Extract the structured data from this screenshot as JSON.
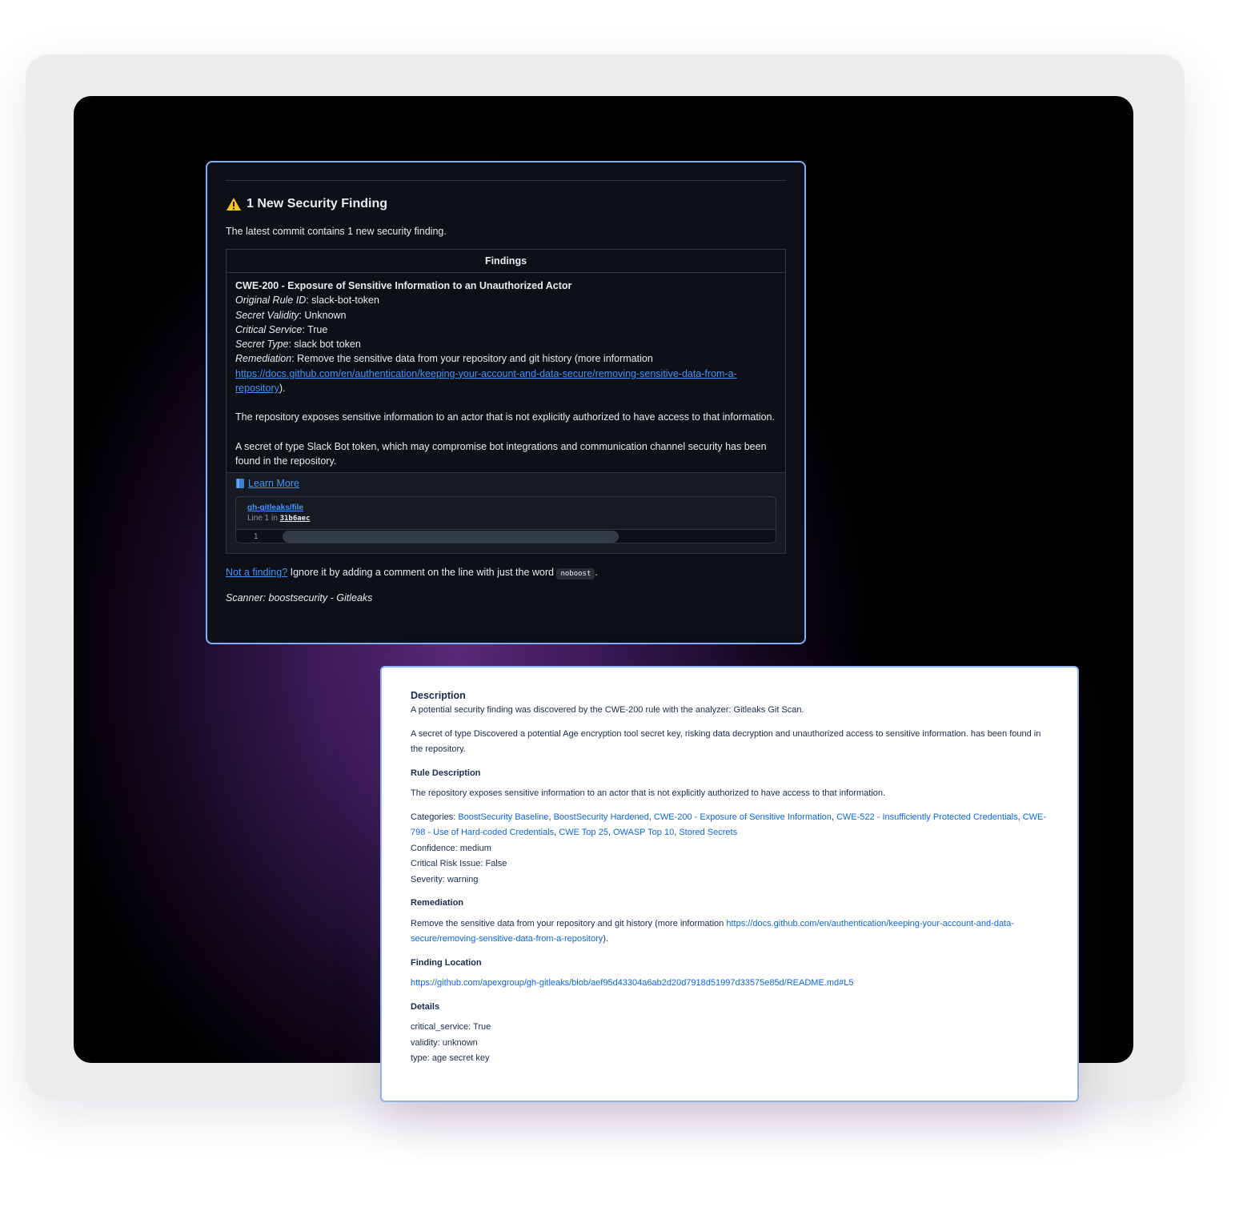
{
  "comment": {
    "title": "1 New Security Finding",
    "intro": "The latest commit contains 1 new security finding.",
    "table_header": "Findings",
    "finding_title": "CWE-200 - Exposure of Sensitive Information to an Unauthorized Actor",
    "fields": [
      {
        "label": "Original Rule ID",
        "value": ": slack-bot-token"
      },
      {
        "label": "Secret Validity",
        "value": ": Unknown"
      },
      {
        "label": "Critical Service",
        "value": ": True"
      },
      {
        "label": "Secret Type",
        "value": ": slack bot token"
      },
      {
        "label": "Remediation",
        "value": ": Remove the sensitive data from your repository and git history (more information"
      }
    ],
    "remediation_link": "https://docs.github.com/en/authentication/keeping-your-account-and-data-secure/removing-sensitive-data-from-a-repository",
    "remediation_end": ").",
    "para1": "The repository exposes sensitive information to an actor that is not explicitly authorized to have access to that information.",
    "para2": "A secret of type Slack Bot token, which may compromise bot integrations and communication channel security has been found in the repository.",
    "learn_more": "Learn More",
    "snippet": {
      "file": "gh-gitleaks/file",
      "line_prefix": "Line 1 in ",
      "commit": "31b6aec",
      "line_number": "1"
    },
    "not_finding_link": "Not a finding?",
    "not_finding_text": " Ignore it by adding a comment on the line with just the word ",
    "keyword": "noboost",
    "period": ".",
    "scanner": "Scanner: boostsecurity - Gitleaks"
  },
  "details": {
    "description_heading": "Description",
    "description_1": "A potential security finding was discovered by the CWE-200 rule with the analyzer: Gitleaks Git Scan.",
    "description_2": "A secret of type Discovered a potential Age encryption tool secret key, risking data decryption and unauthorized access to sensitive information. has been found in the repository.",
    "rule_heading": "Rule Description",
    "rule_text": "The repository exposes sensitive information to an actor that is not explicitly authorized to have access to that information.",
    "categories_label": "Categories: ",
    "categories": [
      "BoostSecurity Baseline",
      "BoostSecurity Hardened",
      "CWE-200 - Exposure of Sensitive Information",
      "CWE-522 - Insufficiently Protected Credentials",
      "CWE-798 - Use of Hard-coded Credentials",
      "CWE Top 25",
      "OWASP Top 10",
      "Stored Secrets"
    ],
    "confidence": "Confidence: medium",
    "critical_risk": "Critical Risk Issue: False",
    "severity": "Severity: warning",
    "remediation_heading": "Remediation",
    "remediation_text": "Remove the sensitive data from your repository and git history (more information ",
    "remediation_link": "https://docs.github.com/en/authentication/keeping-your-account-and-data-secure/removing-sensitive-data-from-a-repository",
    "remediation_end": ").",
    "location_heading": "Finding Location",
    "location_link": "https://github.com/apexgroup/gh-gitleaks/blob/aef95d43304a6ab2d20d7918d51997d33575e85d/README.md#L5",
    "details_heading": "Details",
    "details_items": [
      "critical_service: True",
      "validity: unknown",
      "type: age secret key"
    ]
  },
  "icons": {
    "warning": "warning-triangle-icon",
    "book": "book-icon"
  },
  "colors": {
    "link_dark": "#4493f8",
    "link_light": "#0c66e4",
    "card_border": "#7fb0ff"
  }
}
